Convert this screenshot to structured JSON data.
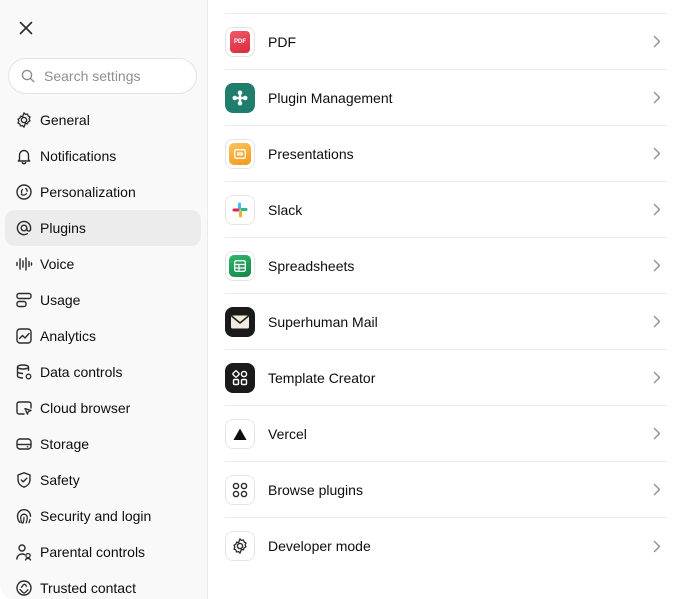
{
  "sidebar": {
    "search": {
      "placeholder": "Search settings",
      "value": ""
    },
    "items": [
      {
        "label": "General",
        "icon": "gear-icon"
      },
      {
        "label": "Notifications",
        "icon": "bell-icon"
      },
      {
        "label": "Personalization",
        "icon": "personalization-icon"
      },
      {
        "label": "Plugins",
        "icon": "at-icon",
        "active": true
      },
      {
        "label": "Voice",
        "icon": "waveform-icon"
      },
      {
        "label": "Usage",
        "icon": "usage-icon"
      },
      {
        "label": "Analytics",
        "icon": "analytics-icon"
      },
      {
        "label": "Data controls",
        "icon": "database-icon"
      },
      {
        "label": "Cloud browser",
        "icon": "cloud-browser-icon"
      },
      {
        "label": "Storage",
        "icon": "storage-icon"
      },
      {
        "label": "Safety",
        "icon": "shield-icon"
      },
      {
        "label": "Security and login",
        "icon": "security-icon"
      },
      {
        "label": "Parental controls",
        "icon": "parental-icon"
      },
      {
        "label": "Trusted contact",
        "icon": "contact-icon"
      }
    ]
  },
  "plugins": [
    {
      "label": "PDF",
      "icon": "pdf-icon",
      "icon_text": "PDF"
    },
    {
      "label": "Plugin Management",
      "icon": "plugin-management-icon"
    },
    {
      "label": "Presentations",
      "icon": "presentations-icon"
    },
    {
      "label": "Slack",
      "icon": "slack-icon"
    },
    {
      "label": "Spreadsheets",
      "icon": "spreadsheets-icon"
    },
    {
      "label": "Superhuman Mail",
      "icon": "mail-icon"
    },
    {
      "label": "Template Creator",
      "icon": "template-icon"
    },
    {
      "label": "Vercel",
      "icon": "vercel-icon"
    },
    {
      "label": "Browse plugins",
      "icon": "browse-grid-icon"
    },
    {
      "label": "Developer mode",
      "icon": "gear-icon"
    }
  ],
  "colors": {
    "active_bg": "#ececec",
    "pdf": "#e8424a",
    "plugin_management": "#1f7d6b",
    "presentations": "#f0a52a",
    "spreadsheets": "#1f9d55",
    "dark_tile": "#1a1a1a"
  }
}
